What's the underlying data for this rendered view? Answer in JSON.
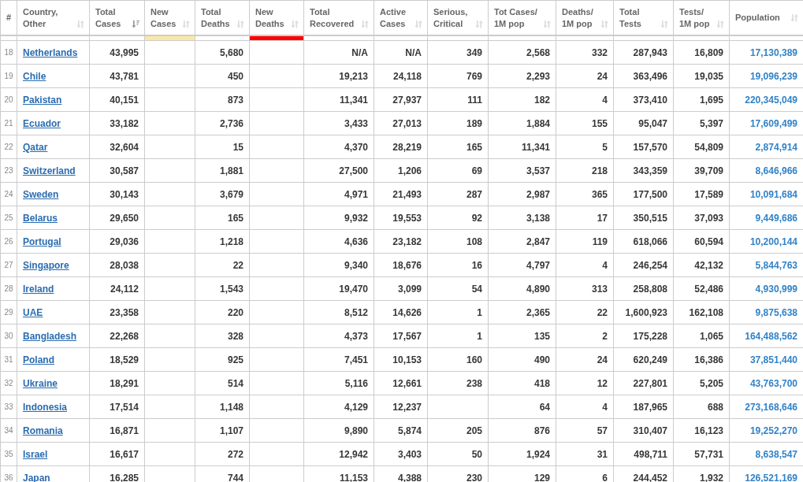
{
  "table": {
    "columns": [
      {
        "label": "#"
      },
      {
        "label": "Country,\nOther",
        "sorted": false
      },
      {
        "label": "Total\nCases",
        "sorted": true
      },
      {
        "label": "New\nCases",
        "sorted": false,
        "color": "#fbe8a6"
      },
      {
        "label": "Total\nDeaths",
        "sorted": false
      },
      {
        "label": "New\nDeaths",
        "sorted": false,
        "color": "#ff0000"
      },
      {
        "label": "Total\nRecovered",
        "sorted": false
      },
      {
        "label": "Active\nCases",
        "sorted": false
      },
      {
        "label": "Serious,\nCritical",
        "sorted": false
      },
      {
        "label": "Tot Cases/\n1M pop",
        "sorted": false
      },
      {
        "label": "Deaths/\n1M pop",
        "sorted": false
      },
      {
        "label": "Total\nTests",
        "sorted": false
      },
      {
        "label": "Tests/\n1M pop",
        "sorted": false
      },
      {
        "label": "Population",
        "sorted": false
      }
    ],
    "rows": [
      {
        "cells": [
          "18",
          "Netherlands",
          "43,995",
          null,
          "5,680",
          null,
          "N/A",
          "N/A",
          "349",
          "2,568",
          "332",
          "287,943",
          "16,809",
          "17,130,389"
        ]
      },
      {
        "cells": [
          "19",
          "Chile",
          "43,781",
          null,
          "450",
          null,
          "19,213",
          "24,118",
          "769",
          "2,293",
          "24",
          "363,496",
          "19,035",
          "19,096,239"
        ]
      },
      {
        "cells": [
          "20",
          "Pakistan",
          "40,151",
          null,
          "873",
          null,
          "11,341",
          "27,937",
          "111",
          "182",
          "4",
          "373,410",
          "1,695",
          "220,345,049"
        ]
      },
      {
        "cells": [
          "21",
          "Ecuador",
          "33,182",
          null,
          "2,736",
          null,
          "3,433",
          "27,013",
          "189",
          "1,884",
          "155",
          "95,047",
          "5,397",
          "17,609,499"
        ]
      },
      {
        "cells": [
          "22",
          "Qatar",
          "32,604",
          null,
          "15",
          null,
          "4,370",
          "28,219",
          "165",
          "11,341",
          "5",
          "157,570",
          "54,809",
          "2,874,914"
        ]
      },
      {
        "cells": [
          "23",
          "Switzerland",
          "30,587",
          null,
          "1,881",
          null,
          "27,500",
          "1,206",
          "69",
          "3,537",
          "218",
          "343,359",
          "39,709",
          "8,646,966"
        ]
      },
      {
        "cells": [
          "24",
          "Sweden",
          "30,143",
          null,
          "3,679",
          null,
          "4,971",
          "21,493",
          "287",
          "2,987",
          "365",
          "177,500",
          "17,589",
          "10,091,684"
        ]
      },
      {
        "cells": [
          "25",
          "Belarus",
          "29,650",
          null,
          "165",
          null,
          "9,932",
          "19,553",
          "92",
          "3,138",
          "17",
          "350,515",
          "37,093",
          "9,449,686"
        ]
      },
      {
        "cells": [
          "26",
          "Portugal",
          "29,036",
          null,
          "1,218",
          null,
          "4,636",
          "23,182",
          "108",
          "2,847",
          "119",
          "618,066",
          "60,594",
          "10,200,144"
        ]
      },
      {
        "cells": [
          "27",
          "Singapore",
          "28,038",
          null,
          "22",
          null,
          "9,340",
          "18,676",
          "16",
          "4,797",
          "4",
          "246,254",
          "42,132",
          "5,844,763"
        ]
      },
      {
        "cells": [
          "28",
          "Ireland",
          "24,112",
          null,
          "1,543",
          null,
          "19,470",
          "3,099",
          "54",
          "4,890",
          "313",
          "258,808",
          "52,486",
          "4,930,999"
        ]
      },
      {
        "cells": [
          "29",
          "UAE",
          "23,358",
          null,
          "220",
          null,
          "8,512",
          "14,626",
          "1",
          "2,365",
          "22",
          "1,600,923",
          "162,108",
          "9,875,638"
        ]
      },
      {
        "cells": [
          "30",
          "Bangladesh",
          "22,268",
          null,
          "328",
          null,
          "4,373",
          "17,567",
          "1",
          "135",
          "2",
          "175,228",
          "1,065",
          "164,488,562"
        ]
      },
      {
        "cells": [
          "31",
          "Poland",
          "18,529",
          null,
          "925",
          null,
          "7,451",
          "10,153",
          "160",
          "490",
          "24",
          "620,249",
          "16,386",
          "37,851,440"
        ]
      },
      {
        "cells": [
          "32",
          "Ukraine",
          "18,291",
          null,
          "514",
          null,
          "5,116",
          "12,661",
          "238",
          "418",
          "12",
          "227,801",
          "5,205",
          "43,763,700"
        ]
      },
      {
        "cells": [
          "33",
          "Indonesia",
          "17,514",
          null,
          "1,148",
          null,
          "4,129",
          "12,237",
          null,
          "64",
          "4",
          "187,965",
          "688",
          "273,168,646"
        ]
      },
      {
        "cells": [
          "34",
          "Romania",
          "16,871",
          null,
          "1,107",
          null,
          "9,890",
          "5,874",
          "205",
          "876",
          "57",
          "310,407",
          "16,123",
          "19,252,270"
        ]
      },
      {
        "cells": [
          "35",
          "Israel",
          "16,617",
          null,
          "272",
          null,
          "12,942",
          "3,403",
          "50",
          "1,924",
          "31",
          "498,711",
          "57,731",
          "8,638,547"
        ]
      },
      {
        "cells": [
          "36",
          "Japan",
          "16,285",
          null,
          "744",
          null,
          "11,153",
          "4,388",
          "230",
          "129",
          "6",
          "244,452",
          "1,932",
          "126,521,169"
        ]
      }
    ]
  }
}
